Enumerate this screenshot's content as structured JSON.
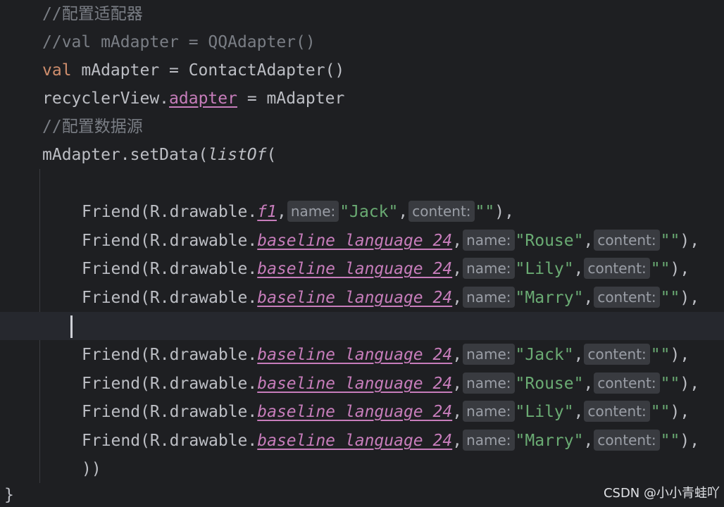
{
  "colors": {
    "background": "#1e1f22",
    "current_line": "#26282e",
    "text": "#bcbec4",
    "comment": "#7a7e85",
    "keyword": "#cf8e6d",
    "property": "#c77dbb",
    "string": "#6aab73",
    "hint_background": "#393b40",
    "hint_text": "#9a9ea6"
  },
  "tokens": {
    "comma": ",",
    "dot": ".",
    "eq": " = ",
    "friend_open": "Friend(R.drawable.",
    "close": "),",
    "empty_str": "\"\"",
    "hint_name": "name:",
    "hint_content": "content:",
    "closing_parens": "))",
    "closing_brace": "}"
  },
  "code": {
    "comment1": "//配置适配器",
    "comment2": "//val mAdapter = QQAdapter()",
    "kw_val": "val",
    "line3_rest": " mAdapter = ContactAdapter()",
    "recycler": "recyclerView",
    "adapter_prop": "adapter",
    "mAdapter": "mAdapter",
    "comment3": "//配置数据源",
    "setdata_pre": "mAdapter.setData(",
    "listof": "listOf",
    "open_paren": "("
  },
  "friends": [
    {
      "drawable": "f1",
      "name": "\"Jack\""
    },
    {
      "drawable": "baseline_language_24",
      "name": "\"Rouse\""
    },
    {
      "drawable": "baseline_language_24",
      "name": "\"Lily\""
    },
    {
      "drawable": "baseline_language_24",
      "name": "\"Marry\""
    },
    {
      "drawable": "baseline_language_24",
      "name": "\"Jack\""
    },
    {
      "drawable": "baseline_language_24",
      "name": "\"Rouse\""
    },
    {
      "drawable": "baseline_language_24",
      "name": "\"Lily\""
    },
    {
      "drawable": "baseline_language_24",
      "name": "\"Marry\""
    }
  ],
  "watermark": "CSDN @小小青蛙吖"
}
